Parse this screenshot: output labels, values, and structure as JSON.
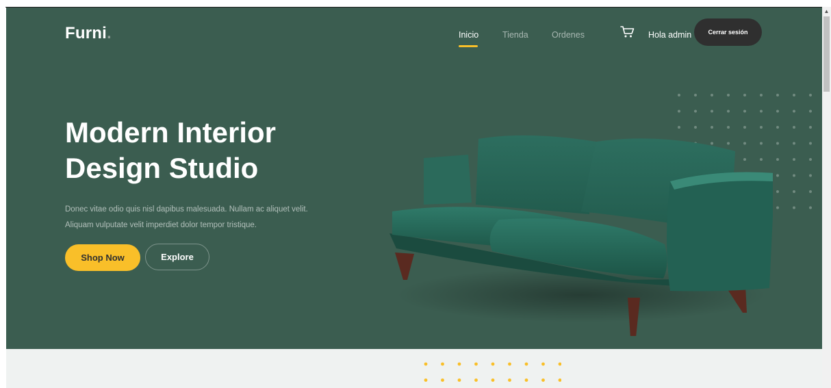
{
  "brand": {
    "name": "Furni",
    "dot": "."
  },
  "nav": {
    "items": [
      {
        "label": "Inicio",
        "active": true
      },
      {
        "label": "Tienda",
        "active": false
      },
      {
        "label": "Ordenes",
        "active": false
      }
    ],
    "cart_icon": "cart-icon",
    "greeting": "Hola admin",
    "logout_label": "Cerrar sesión"
  },
  "hero": {
    "title_line1": "Modern Interior",
    "title_line2": "Design Studio",
    "description": "Donec vitae odio quis nisl dapibus malesuada. Nullam ac aliquet velit. Aliquam vulputate velit imperdiet dolor tempor tristique.",
    "primary_button": "Shop Now",
    "secondary_button": "Explore",
    "image": "green-velvet-sofa"
  },
  "colors": {
    "hero_bg": "#3b5d50",
    "accent": "#f9bf29",
    "dark_button": "#2f2f2f",
    "section_bg": "#eff2f1"
  }
}
